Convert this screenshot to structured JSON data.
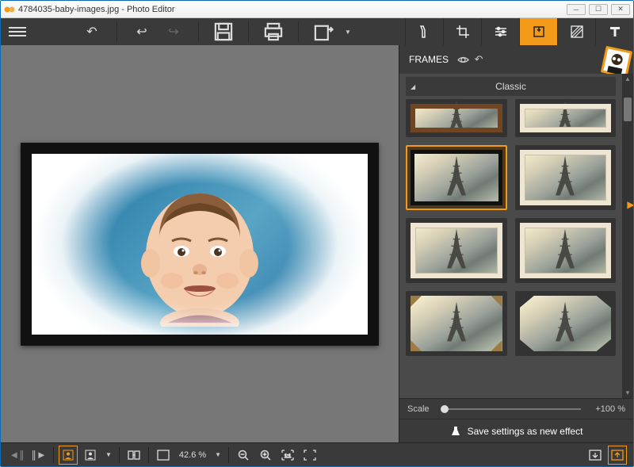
{
  "window": {
    "title": "4784035-baby-images.jpg - Photo Editor"
  },
  "toolbar": {
    "undo_tip": "Undo",
    "back_tip": "Back",
    "forward_tip": "Forward",
    "save_tip": "Save",
    "print_tip": "Print",
    "export_tip": "Export"
  },
  "top_tabs": {
    "labels": [
      "Effects",
      "Crop",
      "Adjust",
      "Frames",
      "Textures",
      "Text"
    ],
    "active_index": 3
  },
  "frames_panel": {
    "title": "FRAMES",
    "category": "Classic",
    "scale_label": "Scale",
    "scale_value": "+100 %",
    "save_effect": "Save settings as new effect"
  },
  "frame_thumbs": [
    {
      "style": "wood",
      "selected": false,
      "half": true
    },
    {
      "style": "cream",
      "selected": false,
      "half": true
    },
    {
      "style": "black",
      "selected": true
    },
    {
      "style": "cream",
      "selected": false
    },
    {
      "style": "cream",
      "selected": false
    },
    {
      "style": "cream",
      "selected": false
    },
    {
      "style": "corners",
      "selected": false
    },
    {
      "style": "octagon",
      "selected": false
    }
  ],
  "bottombar": {
    "zoom": "42.6 %"
  },
  "colors": {
    "accent": "#f39b19",
    "bg_dark": "#3a3a3a",
    "bg_mid": "#4a4a4a",
    "bg_canvas": "#777777"
  }
}
